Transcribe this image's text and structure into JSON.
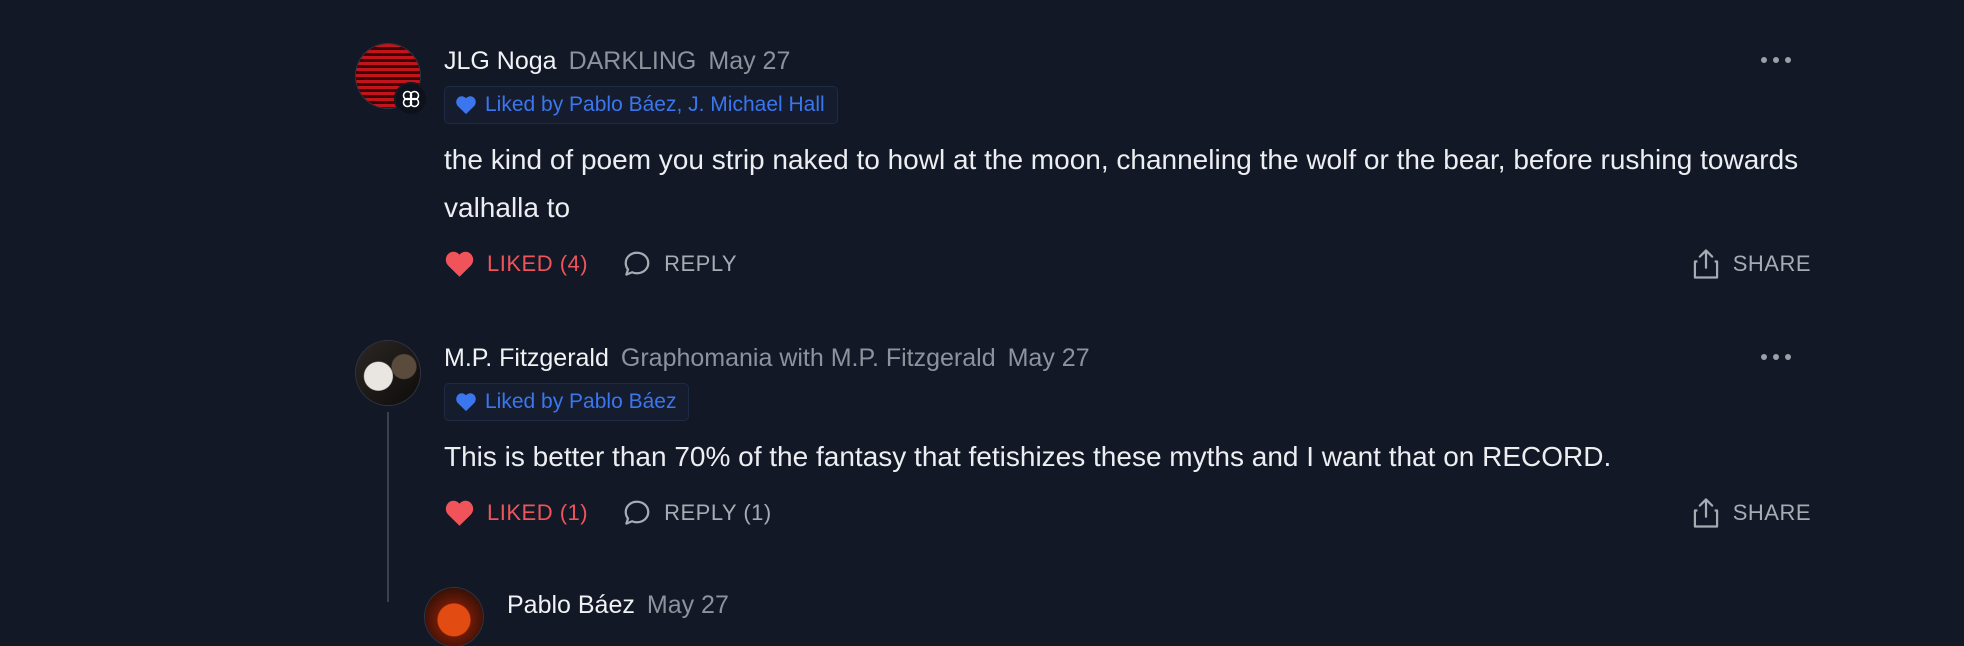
{
  "comments": [
    {
      "author": "JLG Noga",
      "publication": "DARKLING",
      "date": "May 27",
      "liked_by": "Liked by Pablo Báez, J. Michael Hall",
      "text": "the kind of poem you strip naked to howl at the moon, channeling the wolf or the bear, before rushing towards valhalla to",
      "like_label": "LIKED (4)",
      "reply_label": "REPLY",
      "share_label": "SHARE"
    },
    {
      "author": "M.P. Fitzgerald",
      "publication": "Graphomania with M.P. Fitzgerald",
      "date": "May 27",
      "liked_by": "Liked by Pablo Báez",
      "text": "This is better than 70% of the fantasy that fetishizes these myths and I want that on RECORD.",
      "like_label": "LIKED (1)",
      "reply_label": "REPLY (1)",
      "share_label": "SHARE"
    },
    {
      "author": "Pablo Báez",
      "date": "May 27"
    }
  ],
  "icons": {
    "like": "heart-icon",
    "reply": "speech-bubble-icon",
    "share": "share-upload-icon",
    "more": "more-horizontal-icon",
    "liked_by": "heart-icon",
    "publication_badge": "publication-logo-icon"
  },
  "colors": {
    "background": "#121826",
    "liked": "#f0535a",
    "link_blue": "#3b76ee",
    "muted": "#8d929c"
  }
}
